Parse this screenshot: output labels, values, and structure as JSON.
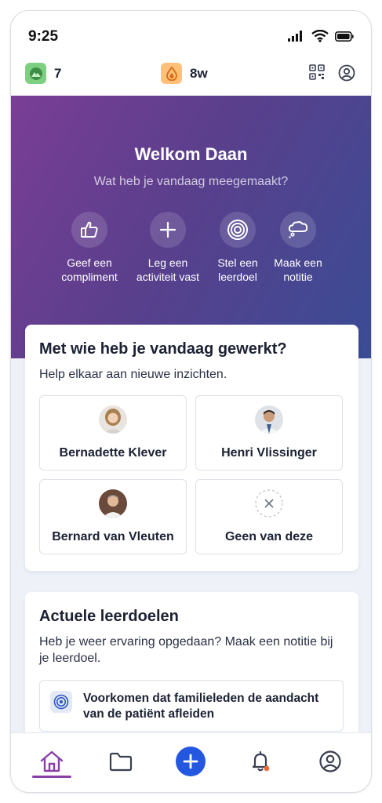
{
  "status_bar": {
    "time": "9:25"
  },
  "app_bar": {
    "streak_count": "7",
    "weeks_count": "8w"
  },
  "hero": {
    "title": "Welkom Daan",
    "subtitle": "Wat heb je vandaag meegemaakt?",
    "actions": [
      {
        "label": "Geef een\ncompliment",
        "icon": "thumbs-up-icon"
      },
      {
        "label": "Leg een\nactiviteit vast",
        "icon": "plus-icon"
      },
      {
        "label": "Stel een\nleerdoel",
        "icon": "target-icon"
      },
      {
        "label": "Maak een\nnotitie",
        "icon": "thought-bubble-icon"
      }
    ]
  },
  "colleagues": {
    "title": "Met wie heb je vandaag gewerkt?",
    "subtitle": "Help elkaar aan nieuwe inzichten.",
    "people": [
      {
        "name": "Bernadette Klever"
      },
      {
        "name": "Henri Vlissinger"
      },
      {
        "name": "Bernard van Vleuten"
      },
      {
        "name": "Geen van deze"
      }
    ]
  },
  "goals": {
    "title": "Actuele leerdoelen",
    "subtitle": "Heb je weer ervaring opgedaan? Maak een notitie bij je leerdoel.",
    "items": [
      {
        "text": "Voorkomen dat familieleden de aandacht van de patiënt afleiden"
      }
    ]
  },
  "bottom_nav": {
    "items": [
      "home-icon",
      "folder-icon",
      "add-icon",
      "bell-icon",
      "profile-icon"
    ]
  },
  "colors": {
    "accent_purple": "#8a3fa6",
    "primary_blue": "#2457e0",
    "notification_dot": "#f06a3c"
  }
}
